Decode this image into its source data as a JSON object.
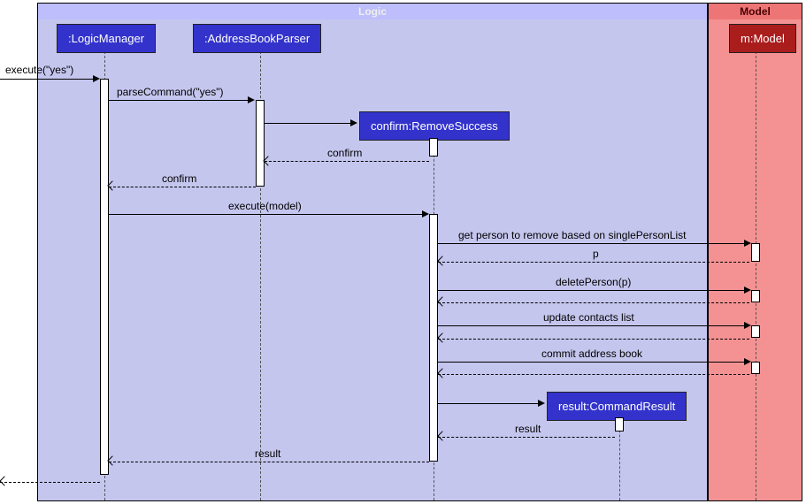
{
  "groups": {
    "logic": {
      "label": "Logic",
      "color": "#c5c6ee",
      "header": "#bdbefb"
    },
    "model": {
      "label": "Model",
      "color": "#f49293",
      "header": "#ee7576"
    }
  },
  "participants": {
    "logicManager": {
      "label": ":LogicManager",
      "color": "#3333cc"
    },
    "parser": {
      "label": ":AddressBookParser",
      "color": "#3333cc"
    },
    "removeSuccess": {
      "label": "confirm:RemoveSuccess",
      "color": "#3333cc"
    },
    "commandResult": {
      "label": "result:CommandResult",
      "color": "#3333cc"
    },
    "model": {
      "label": "m:Model",
      "color": "#aa1d1d"
    }
  },
  "messages": {
    "executeYes": "execute(\"yes\")",
    "parseCommand": "parseCommand(\"yes\")",
    "confirm1": "confirm",
    "confirm2": "confirm",
    "executeModel": "execute(model)",
    "getPerson": "get person to remove based on singlePersonList",
    "p": "p",
    "deletePerson": "deletePerson(p)",
    "updateContacts": "update contacts list",
    "commitBook": "commit address book",
    "result1": "result",
    "result2": "result"
  }
}
